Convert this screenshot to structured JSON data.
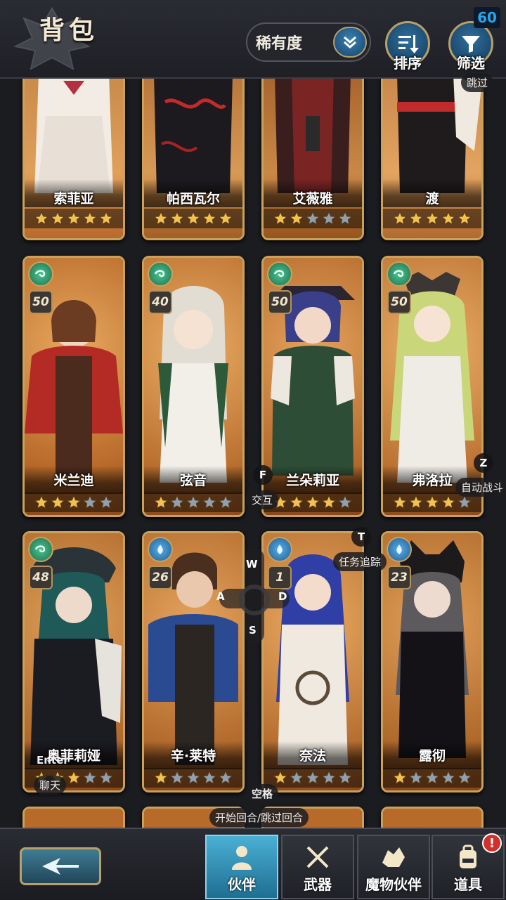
{
  "header": {
    "title": "背包",
    "sort_select": {
      "value": "稀有度",
      "icon": "chevron-double-down-icon"
    },
    "sort_button": {
      "label": "排序",
      "icon": "sort-icon"
    },
    "filter_button": {
      "label": "筛选",
      "icon": "filter-funnel-icon"
    },
    "fps": "60"
  },
  "cards_top_partial": [
    {
      "name": "索菲亚",
      "stars": 5,
      "gold_stars": 5
    },
    {
      "name": "帕西瓦尔",
      "stars": 5,
      "gold_stars": 5
    },
    {
      "name": "艾薇雅",
      "stars": 5,
      "gold_stars": 2
    },
    {
      "name": "渡",
      "stars": 5,
      "gold_stars": 5
    }
  ],
  "cards_row2": [
    {
      "name": "米兰迪",
      "level": "50",
      "element": "wind",
      "stars": 5,
      "gold_stars": 3
    },
    {
      "name": "弦音",
      "level": "40",
      "element": "wind",
      "stars": 5,
      "gold_stars": 1
    },
    {
      "name": "兰朵莉亚",
      "level": "50",
      "element": "wind",
      "stars": 5,
      "gold_stars": 4
    },
    {
      "name": "弗洛拉",
      "level": "50",
      "element": "wind",
      "stars": 5,
      "gold_stars": 4
    }
  ],
  "cards_row3": [
    {
      "name": "奥菲莉娅",
      "level": "48",
      "element": "wind",
      "stars": 5,
      "gold_stars": 3
    },
    {
      "name": "辛·莱特",
      "level": "26",
      "element": "water",
      "stars": 5,
      "gold_stars": 1
    },
    {
      "name": "奈法",
      "level": "1",
      "element": "water",
      "stars": 5,
      "gold_stars": 1
    },
    {
      "name": "露彻",
      "level": "23",
      "element": "water",
      "stars": 5,
      "gold_stars": 1
    }
  ],
  "overlay_hints": {
    "skip": "跳过",
    "interact_key": "F",
    "interact": "交互",
    "auto_battle_key": "Z",
    "auto_battle": "自动战斗",
    "quest_track_key": "T",
    "quest_track": "任务追踪",
    "chat_key": "Enter",
    "chat": "聊天",
    "space_key": "空格",
    "turn": "开始回合/跳过回合",
    "dpad": {
      "up": "W",
      "left": "A",
      "right": "D",
      "down": "S"
    }
  },
  "bottom_tabs": [
    {
      "label": "伙伴",
      "icon": "partner-bust-icon",
      "active": true
    },
    {
      "label": "武器",
      "icon": "crossed-swords-icon",
      "active": false
    },
    {
      "label": "魔物伙伴",
      "icon": "dragon-head-icon",
      "active": false
    },
    {
      "label": "道具",
      "icon": "backpack-icon",
      "active": false,
      "badge": "!"
    }
  ],
  "colors": {
    "card_border": "#c9a15a",
    "star_gold": "#f2c14e",
    "star_gray": "#8fa0b3",
    "wind_element": "#2f9a6b",
    "water_element": "#2b78b8",
    "active_tab": "#3a9fc6"
  }
}
